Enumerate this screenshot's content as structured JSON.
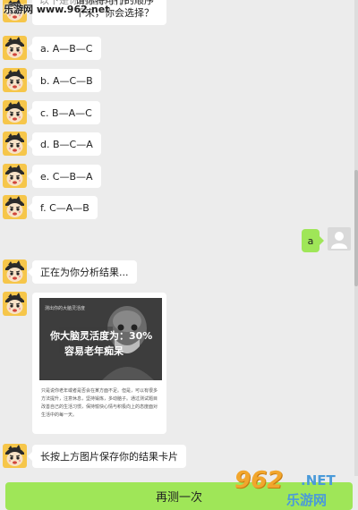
{
  "watermark": {
    "text": "乐游网 www.962.net"
  },
  "top_message": {
    "line1": "请你将可行的顺序",
    "line2": "下来，你会选择？",
    "overlay": "以下是你的脑龄测评"
  },
  "options": [
    {
      "label": "a. A—B—C"
    },
    {
      "label": "b. A—C—B"
    },
    {
      "label": "c. B—A—C"
    },
    {
      "label": "d. B—C—A"
    },
    {
      "label": "e. C—B—A"
    },
    {
      "label": "f. C—A—B"
    }
  ],
  "user_reply": {
    "text": "a"
  },
  "analyzing": {
    "text": "正在为你分析结果..."
  },
  "result_card": {
    "subtitle": "测出你的大脑灵活度",
    "title_line1": "你大脑灵活度为：30%",
    "title_line2": "容易老年痴呆",
    "body": "只是说你老年或者是否会在某方面不足。但是，可以有很多方法提升，注意休息，坚持锻炼，多动脑子。通过测试题目改善自己的生活习惯，保持愉快心情与积极向上的态度面对生活中的每一天。"
  },
  "save_hint": {
    "text": "长按上方图片保存你的结果卡片"
  },
  "footer": {
    "retry_label": "再测一次"
  },
  "logo": {
    "number": "962",
    "domain": ".NET",
    "site_name": "乐游网"
  },
  "colors": {
    "accent": "#9fe658",
    "background": "#ececec",
    "logo_orange": "#f2a62d",
    "logo_blue": "#4a9ad9"
  }
}
